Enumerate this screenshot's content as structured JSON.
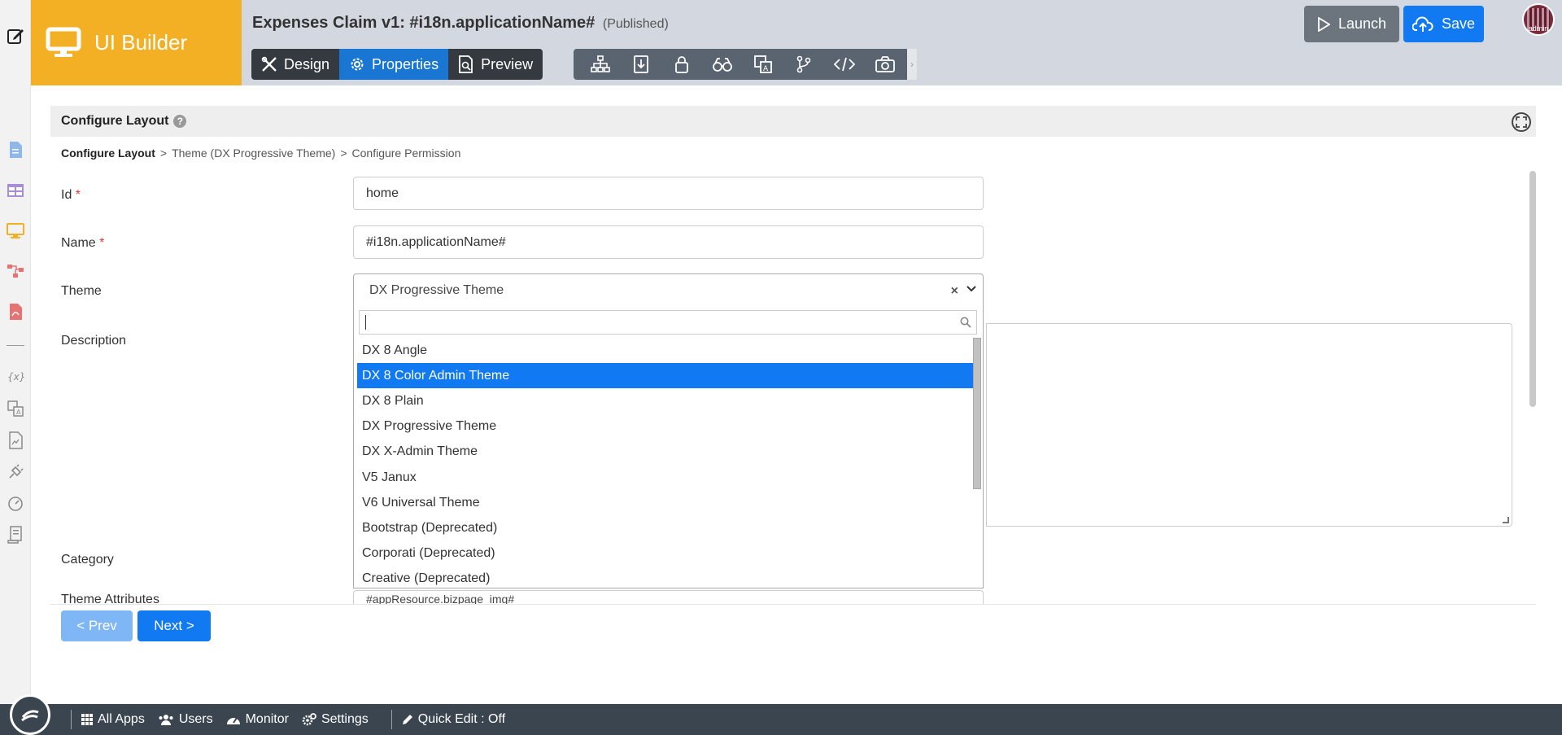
{
  "header": {
    "brand_label": "UI Builder",
    "app_title": "Expenses Claim v1: #i18n.applicationName#",
    "app_status": "(Published)",
    "mode_tabs": [
      {
        "label": "Design",
        "icon": "design-tools-icon",
        "active": false
      },
      {
        "label": "Properties",
        "icon": "gear-icon",
        "active": true
      },
      {
        "label": "Preview",
        "icon": "preview-doc-icon",
        "active": false
      }
    ],
    "tool_icons": [
      "sitemap-icon",
      "import-icon",
      "lock-icon",
      "binoculars-icon",
      "translate-icon",
      "branch-icon",
      "code-icon",
      "camera-icon"
    ],
    "launch_label": "Launch",
    "save_label": "Save",
    "avatar_label": "admin"
  },
  "left_strip": {
    "icons": [
      "edit-icon",
      "document-icon",
      "table-icon",
      "monitor-icon",
      "process-icon",
      "pdf-icon",
      "variable-icon",
      "translate-icon",
      "report-icon",
      "plugin-icon",
      "performance-icon",
      "script-icon"
    ],
    "colors": {
      "document": "#8fb8e8",
      "table": "#a88ed6",
      "monitor": "#f4b025",
      "process": "#e57373",
      "pdf": "#e57373",
      "gray": "#8a8a8a"
    }
  },
  "panel": {
    "title": "Configure Layout",
    "breadcrumb": [
      "Configure Layout",
      ">",
      "Theme (DX Progressive Theme)",
      ">",
      "Configure Permission"
    ]
  },
  "form": {
    "id_label": "Id",
    "id_value": "home",
    "name_label": "Name",
    "name_value": "#i18n.applicationName#",
    "required_mark": "*",
    "theme_label": "Theme",
    "theme_value": "DX Progressive Theme",
    "theme_clear": "×",
    "description_label": "Description",
    "category_label": "Category",
    "hidden_row_label": "Theme Attributes",
    "hidden_row_value": "#appResource.bizpage_img#"
  },
  "dropdown": {
    "search_value": "",
    "options": [
      {
        "label": "DX 8 Angle",
        "selected": false
      },
      {
        "label": "DX 8 Color Admin Theme",
        "selected": true
      },
      {
        "label": "DX 8 Plain",
        "selected": false
      },
      {
        "label": "DX Progressive Theme",
        "selected": false
      },
      {
        "label": "DX X-Admin Theme",
        "selected": false
      },
      {
        "label": "V5 Janux",
        "selected": false
      },
      {
        "label": "V6 Universal Theme",
        "selected": false
      },
      {
        "label": "Bootstrap (Deprecated)",
        "selected": false
      },
      {
        "label": "Corporati (Deprecated)",
        "selected": false
      },
      {
        "label": "Creative (Deprecated)",
        "selected": false
      }
    ]
  },
  "nav_buttons": {
    "prev": "< Prev",
    "next": "Next >"
  },
  "footer": {
    "items": [
      {
        "label": "All Apps",
        "icon": "grid-icon"
      },
      {
        "label": "Users",
        "icon": "users-icon"
      },
      {
        "label": "Monitor",
        "icon": "gauge-icon"
      },
      {
        "label": "Settings",
        "icon": "gears-icon"
      }
    ],
    "quick_edit": "Quick Edit : Off"
  },
  "colors": {
    "brand": "#f4b025",
    "primary": "#1179f2",
    "dark": "#343a40",
    "footer": "#3b4550"
  }
}
